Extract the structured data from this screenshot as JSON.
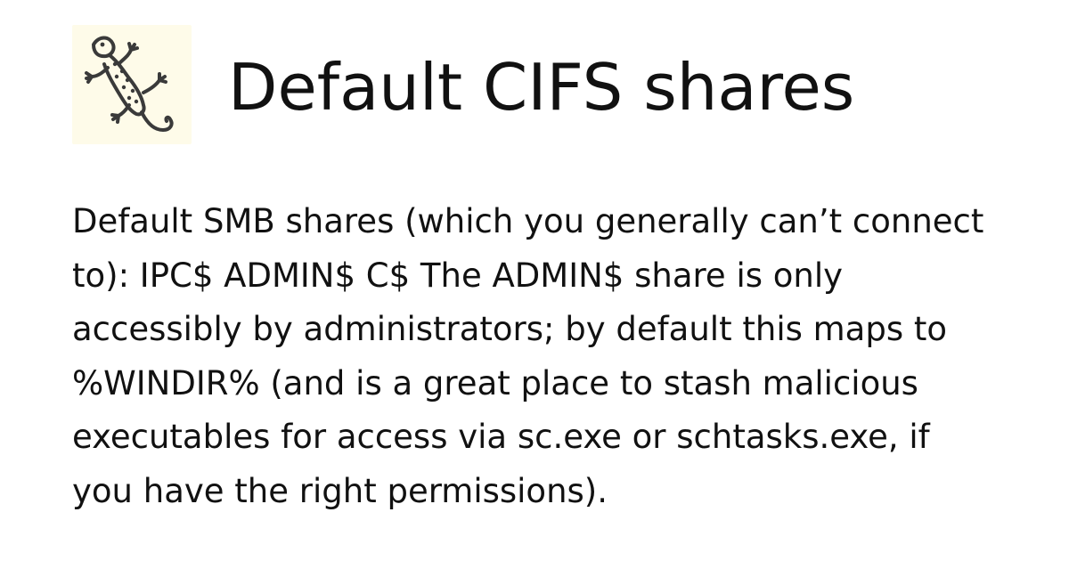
{
  "header": {
    "logo_icon": "gecko-icon",
    "logo_background": "#fefbe9",
    "title": "Default CIFS shares"
  },
  "main": {
    "description": "Default SMB shares (which you generally can’t connect to): IPC$ ADMIN$ C$ The ADMIN$ share is only accessibly by administrators; by default this maps to %WINDIR% (and is a great place to stash malicious executables for access via sc.exe or schtasks.exe, if you have the right permissions)."
  },
  "colors": {
    "text": "#111111",
    "background": "#ffffff",
    "logo_stroke": "#3a3a3a"
  }
}
